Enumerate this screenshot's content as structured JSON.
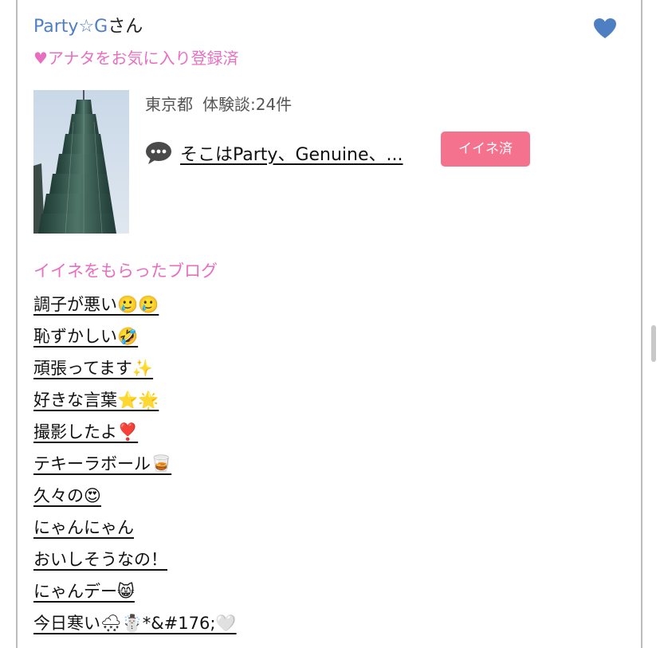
{
  "profile": {
    "name": "Party☆G",
    "honorific": "さん",
    "favorite_status": "♥アナタをお気に入り登録済",
    "location": "東京都",
    "review_count": "体験談:24件"
  },
  "comment": {
    "icon": "speech-bubble-icon",
    "text": "そこはParty、Genuine、...",
    "like_button_label": "イイネ済"
  },
  "blogs": {
    "title": "イイネをもらったブログ",
    "items": [
      {
        "label": "調子が悪い🥲🥲"
      },
      {
        "label": "恥ずかしい🤣"
      },
      {
        "label": "頑張ってます✨"
      },
      {
        "label": "好きな言葉⭐🌟"
      },
      {
        "label": "撮影したよ❣️"
      },
      {
        "label": "テキーラボール🥃"
      },
      {
        "label": "久々の😍"
      },
      {
        "label": "にゃんにゃん"
      },
      {
        "label": "おいしそうなの！"
      },
      {
        "label": "にゃんデー😸"
      },
      {
        "label": "今日寒い🌨☃️*&#176;🤍"
      }
    ]
  },
  "colors": {
    "name_blue": "#4f7fc3",
    "favorite_pink": "#e86fc0",
    "button_pink": "#f5728f",
    "heart_blue": "#4f7fc3"
  }
}
